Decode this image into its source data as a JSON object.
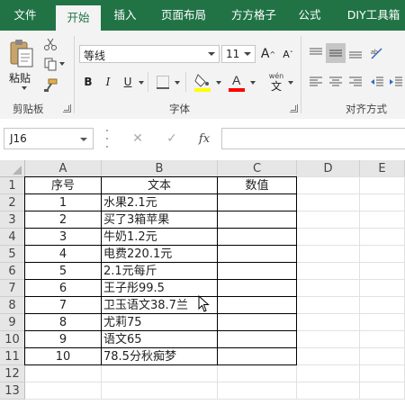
{
  "tabs": [
    {
      "label": "文件",
      "active": false
    },
    {
      "label": "开始",
      "active": true
    },
    {
      "label": "插入",
      "active": false
    },
    {
      "label": "页面布局",
      "active": false
    },
    {
      "label": "方方格子",
      "active": false
    },
    {
      "label": "公式",
      "active": false
    },
    {
      "label": "DIY工具箱",
      "active": false
    }
  ],
  "clipboard": {
    "paste_label": "粘贴",
    "group_label": "剪贴板"
  },
  "font": {
    "name": "等线",
    "size": "11",
    "group_label": "字体",
    "bold": "B",
    "italic": "I",
    "underline": "U",
    "grow": "A",
    "shrink": "A",
    "phonetic_top": "wén",
    "phonetic_bottom": "文"
  },
  "alignment": {
    "group_label": "对齐方式"
  },
  "formula_bar": {
    "cell_ref": "J16",
    "fx": "fx",
    "cancel": "✕",
    "enter": "✓",
    "content": ""
  },
  "columns": [
    "A",
    "B",
    "C",
    "D",
    "E"
  ],
  "rows": [
    "1",
    "2",
    "3",
    "4",
    "5",
    "6",
    "7",
    "8",
    "9",
    "10",
    "11",
    "12",
    "13"
  ],
  "table": {
    "headers": [
      "序号",
      "文本",
      "数值"
    ],
    "data": [
      [
        "1",
        "水果2.1元",
        ""
      ],
      [
        "2",
        "买了3箱苹果",
        ""
      ],
      [
        "3",
        "牛奶1.2元",
        ""
      ],
      [
        "4",
        "电费220.1元",
        ""
      ],
      [
        "5",
        "2.1元每斤",
        ""
      ],
      [
        "6",
        "王子彤99.5",
        ""
      ],
      [
        "7",
        "卫玉语文38.7兰",
        ""
      ],
      [
        "8",
        "尤莉75",
        ""
      ],
      [
        "9",
        "语文65",
        ""
      ],
      [
        "10",
        "78.5分秋痴梦",
        ""
      ]
    ]
  },
  "colors": {
    "accent": "#217346",
    "font_highlight": "#ffff00",
    "font_color": "#ff0000"
  }
}
